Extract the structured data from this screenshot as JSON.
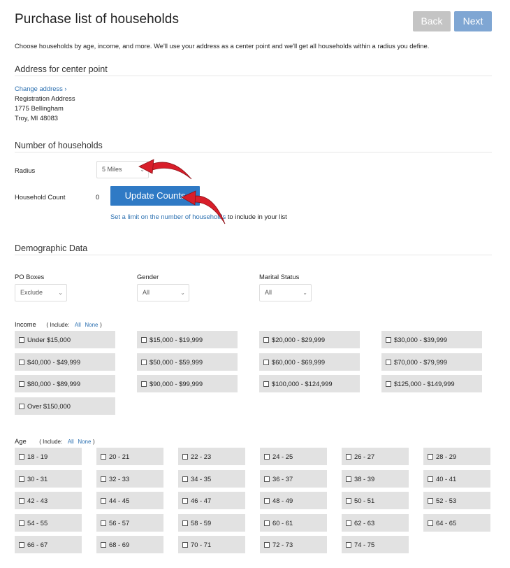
{
  "header": {
    "title": "Purchase list of households",
    "back_label": "Back",
    "next_label": "Next",
    "intro": "Choose households by age, income, and more. We'll use your address as a center point and we'll get all households within a radius you define."
  },
  "address": {
    "section_title": "Address for center point",
    "change_link": "Change address ›",
    "line1": "Registration Address",
    "line2": "1775 Bellingham",
    "line3": "Troy, MI 48083"
  },
  "households": {
    "section_title": "Number of households",
    "radius_label": "Radius",
    "radius_value": "5 Miles",
    "count_label": "Household Count",
    "count_value": "0",
    "update_label": "Update Counts",
    "limit_link": "Set a limit on the number of households",
    "limit_suffix": "to include in your list"
  },
  "demographic": {
    "section_title": "Demographic Data",
    "po_boxes_label": "PO Boxes",
    "po_boxes_value": "Exclude",
    "gender_label": "Gender",
    "gender_value": "All",
    "marital_label": "Marital Status",
    "marital_value": "All"
  },
  "income": {
    "label": "Income",
    "include_label": "( Include:",
    "all_label": "All",
    "none_label": "None",
    "close_paren": ")",
    "options": [
      "Under $15,000",
      "$15,000 - $19,999",
      "$20,000 - $29,999",
      "$30,000 - $39,999",
      "$40,000 - $49,999",
      "$50,000 - $59,999",
      "$60,000 - $69,999",
      "$70,000 - $79,999",
      "$80,000 - $89,999",
      "$90,000 - $99,999",
      "$100,000 - $124,999",
      "$125,000 - $149,999",
      "Over $150,000"
    ]
  },
  "age": {
    "label": "Age",
    "include_label": "( Include:",
    "all_label": "All",
    "none_label": "None",
    "close_paren": ")",
    "options": [
      "18 - 19",
      "20 - 21",
      "22 - 23",
      "24 - 25",
      "26 - 27",
      "28 - 29",
      "30 - 31",
      "32 - 33",
      "34 - 35",
      "36 - 37",
      "38 - 39",
      "40 - 41",
      "42 - 43",
      "44 - 45",
      "46 - 47",
      "48 - 49",
      "50 - 51",
      "52 - 53",
      "54 - 55",
      "56 - 57",
      "58 - 59",
      "60 - 61",
      "62 - 63",
      "64 - 65",
      "66 - 67",
      "68 - 69",
      "70 - 71",
      "72 - 73",
      "74 - 75"
    ]
  },
  "colors": {
    "accent": "#2f7ac5",
    "link": "#2a6fb0",
    "annotation_arrow": "#d81e2a"
  }
}
